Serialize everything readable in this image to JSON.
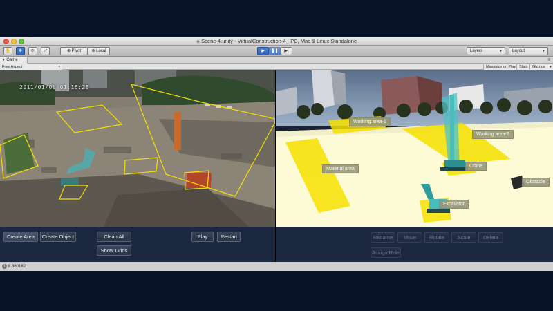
{
  "window": {
    "title": "Scene-4.unity - VirtualConstruction-4 - PC, Mac & Linux Standalone"
  },
  "toolbar": {
    "pivot_label": "Pivot",
    "space_label": "Local",
    "layers_label": "Layers",
    "layout_label": "Layout"
  },
  "tabs": {
    "game_label": "Game"
  },
  "game_options": {
    "aspect_label": "Free Aspect",
    "maximize_label": "Maximize on Play",
    "stats_label": "Stats",
    "gizmos_label": "Gizmos"
  },
  "camera_view": {
    "timestamp": "2011/01/08 01:16:28"
  },
  "sim_view": {
    "labels": {
      "working_area_1": "Working area-1",
      "working_area_2": "Working area-2",
      "material_area": "Material area",
      "crane": "Crane",
      "excavator": "Excavator",
      "obstacle": "Obstacle"
    }
  },
  "left_panel": {
    "create_area": "Create Area",
    "create_object": "Create Object",
    "clean_all": "Clean All",
    "show_grids": "Show Grids",
    "play": "Play",
    "restart": "Restart"
  },
  "right_panel": {
    "rename": "Rename",
    "move": "Move",
    "rotate": "Rotate",
    "scale": "Scale",
    "delete": "Delete",
    "assign_role": "Assign Role"
  },
  "status": {
    "message": "8.360182"
  },
  "colors": {
    "area_highlight": "#f5e000",
    "selected_object": "#55c8c8",
    "panel_bg": "#1c2740",
    "desktop_bg": "#081226"
  }
}
